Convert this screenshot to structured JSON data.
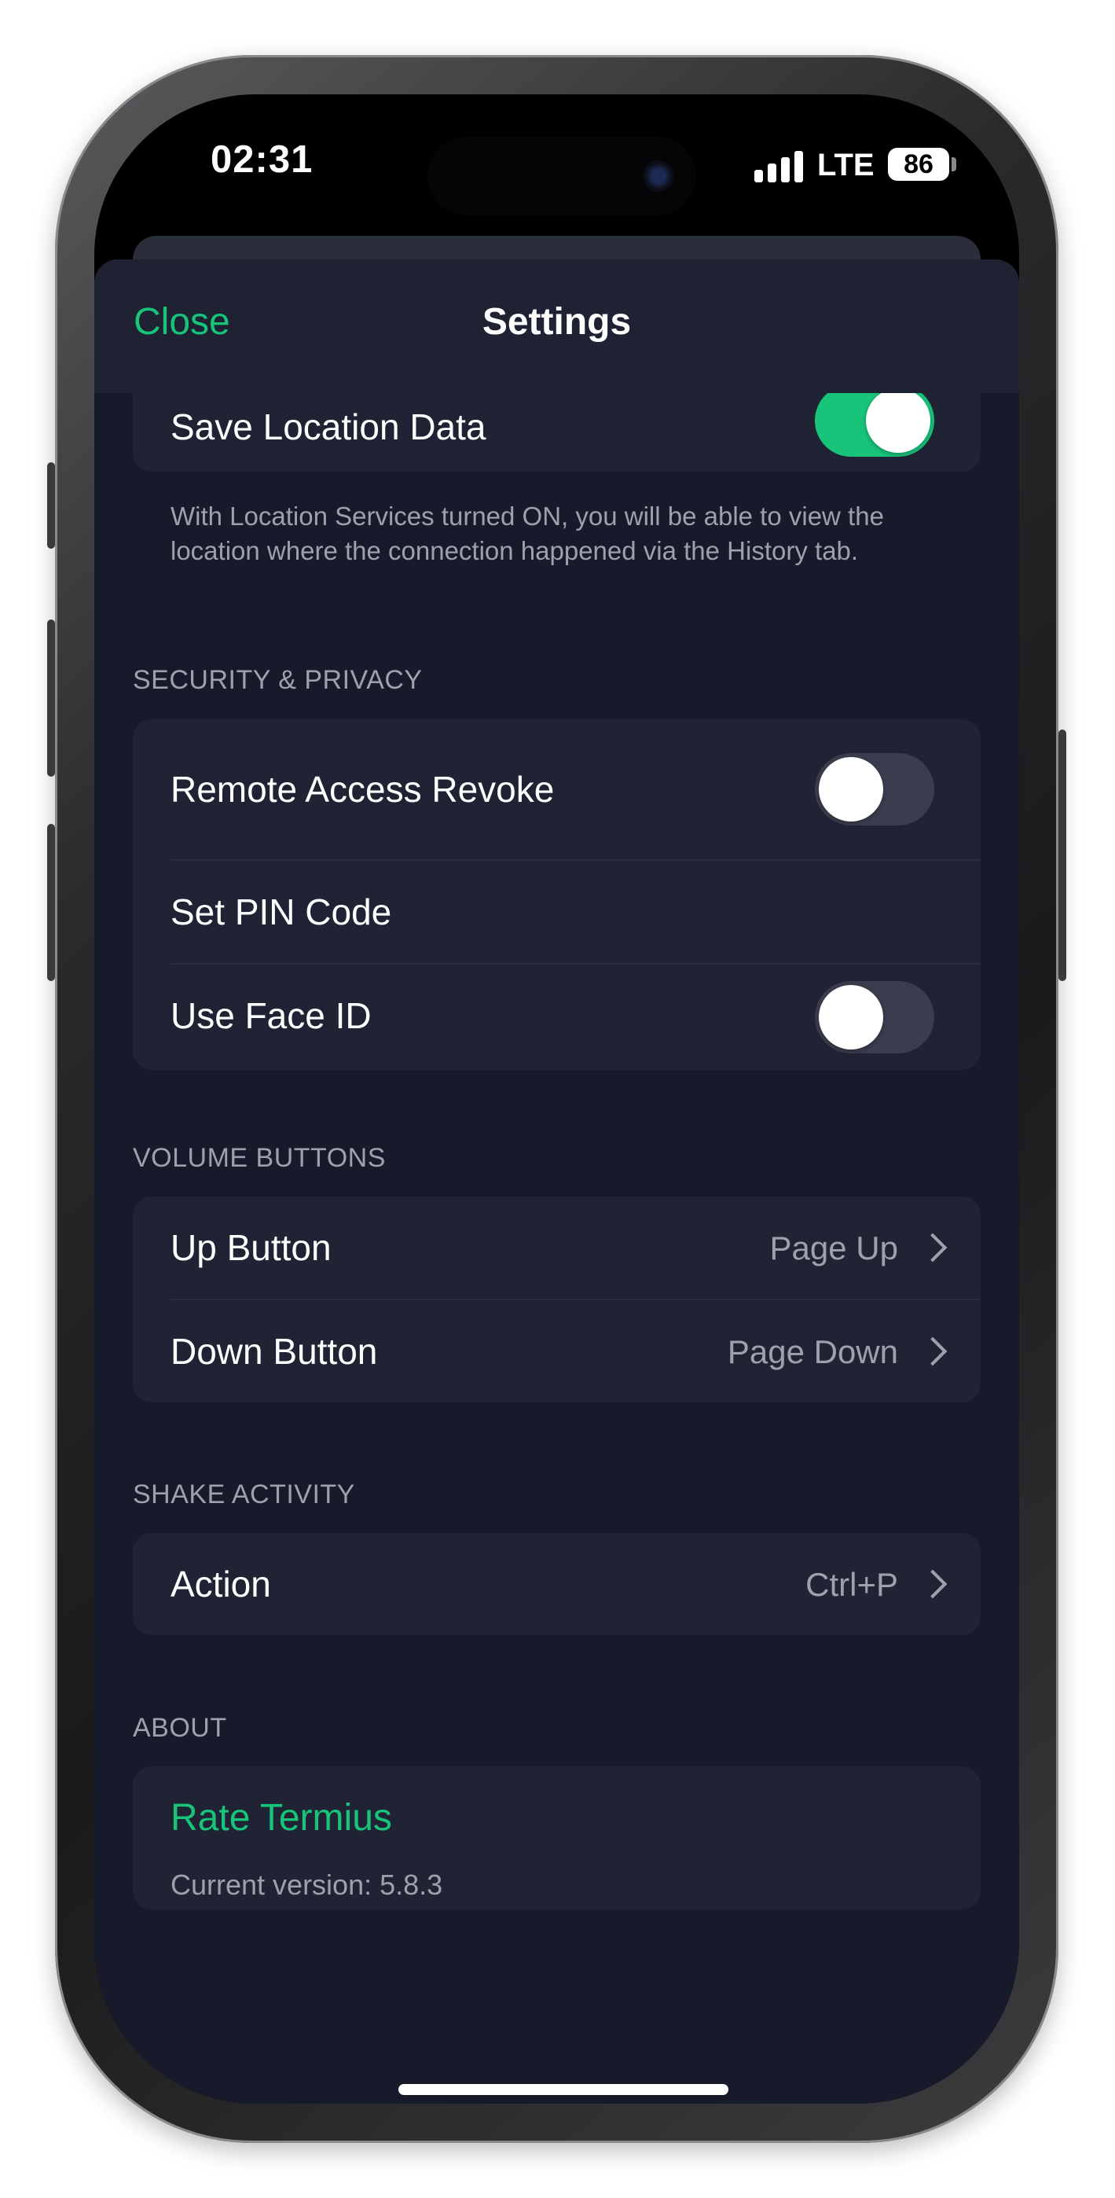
{
  "status_bar": {
    "time": "02:31",
    "network": "LTE",
    "battery": "86"
  },
  "nav": {
    "close_label": "Close",
    "title": "Settings"
  },
  "location": {
    "save_label": "Save Location Data",
    "save_on": true,
    "note": "With Location Services turned ON, you will be able to view the location where the connection happened via the History tab."
  },
  "security": {
    "header": "SECURITY & PRIVACY",
    "remote_revoke_label": "Remote Access Revoke",
    "remote_revoke_on": false,
    "pin_label": "Set PIN Code",
    "face_id_label": "Use Face ID",
    "face_id_on": false
  },
  "volume": {
    "header": "VOLUME BUTTONS",
    "up_label": "Up Button",
    "up_value": "Page Up",
    "down_label": "Down Button",
    "down_value": "Page Down"
  },
  "shake": {
    "header": "SHAKE ACTIVITY",
    "action_label": "Action",
    "action_value": "Ctrl+P"
  },
  "about": {
    "header": "ABOUT",
    "rate_label": "Rate Termius",
    "version": "Current version: 5.8.3"
  },
  "colors": {
    "accent": "#17c47a",
    "background": "#171a2b",
    "card": "#202334"
  }
}
